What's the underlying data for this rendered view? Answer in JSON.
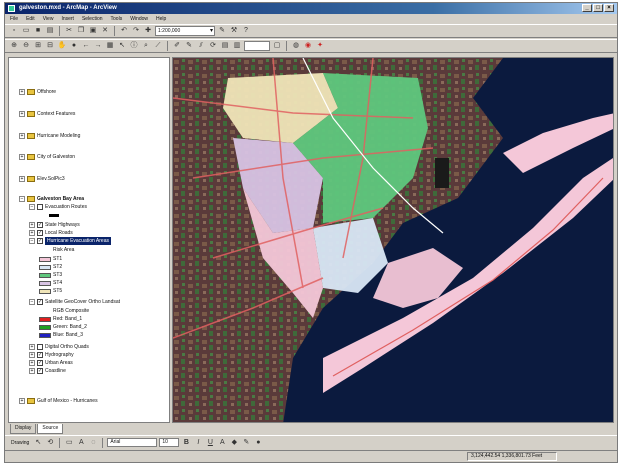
{
  "window": {
    "title": "galveston.mxd - ArcMap - ArcView"
  },
  "menubar": {
    "items": [
      "File",
      "Edit",
      "View",
      "Insert",
      "Selection",
      "Tools",
      "Window",
      "Help"
    ]
  },
  "toolbar": {
    "scale": "1:200,000"
  },
  "toc": {
    "frames": {
      "offshore": "Offshore",
      "context_features": "Context Features",
      "hurricane_modeling": "Hurricane Modeling",
      "city_of_galveston": "City of Galveston",
      "elev_solarpic": "Elev.SolPic3",
      "bay_area": "Galveston Bay Area",
      "gulf_of_mexico": "Gulf of Mexico - Hurricanes"
    },
    "layers": {
      "evacuation_routes": "Evacuation Routes",
      "state_highways": "State Highways",
      "local_roads": "Local Roads",
      "evacuation_zones": "Hurricane Evacuation Areas",
      "satellite": "Satellite GeoCover Ortho Landsat",
      "digital_ortho_quads": "Digital Ortho Quads",
      "hydrography": "Hydrography",
      "urban_areas": "Urban Areas",
      "coastline": "Coastline"
    },
    "risk_heading": "Risk Area",
    "risk_classes": [
      {
        "label": "ST1",
        "color": "#f4c7d8"
      },
      {
        "label": "ST2",
        "color": "#d9e7f5"
      },
      {
        "label": "ST3",
        "color": "#5fc77d"
      },
      {
        "label": "ST4",
        "color": "#d8c3e4"
      },
      {
        "label": "ST5",
        "color": "#f0e5b8"
      }
    ],
    "rgb_heading": "RGB Composite",
    "rgb_bands": [
      {
        "label": "Red:  Band_1",
        "color": "#e02020"
      },
      {
        "label": "Green: Band_2",
        "color": "#20a020"
      },
      {
        "label": "Blue:  Band_3",
        "color": "#2020c0"
      }
    ],
    "tabs": [
      "Display",
      "Source"
    ]
  },
  "drawing": {
    "label": "Drawing",
    "font": "Arial",
    "size": "10"
  },
  "status": {
    "coordinates": "3,124,442.54  1,336,801.73 Feet"
  },
  "colors": {
    "titlebar": "#0a246a",
    "selection": "#0a246a",
    "water": "#0b1a3e",
    "land": "#5a3a3a"
  }
}
